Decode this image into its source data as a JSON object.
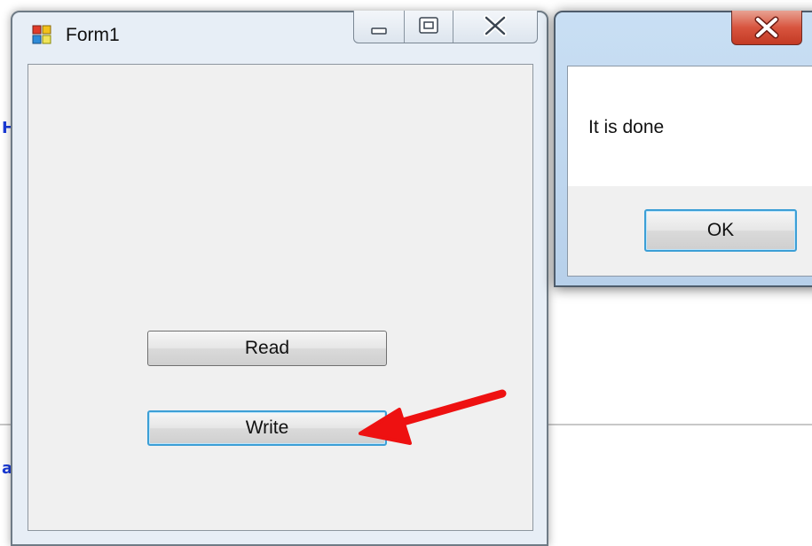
{
  "form": {
    "title": "Form1",
    "icon": "winforms-app-icon",
    "caption_buttons": [
      "minimize-icon",
      "restore-icon",
      "close-icon"
    ],
    "read_button_label": "Read",
    "write_button_label": "Write"
  },
  "message_box": {
    "text": "It is done",
    "ok_label": "OK",
    "close_icon": "close-icon"
  },
  "background": {
    "glyph_1": "H",
    "glyph_2": "a"
  },
  "colors": {
    "focus_border": "#3c9fd6",
    "close_button_red": "#c33a24",
    "annotation_arrow": "#ee1111"
  }
}
